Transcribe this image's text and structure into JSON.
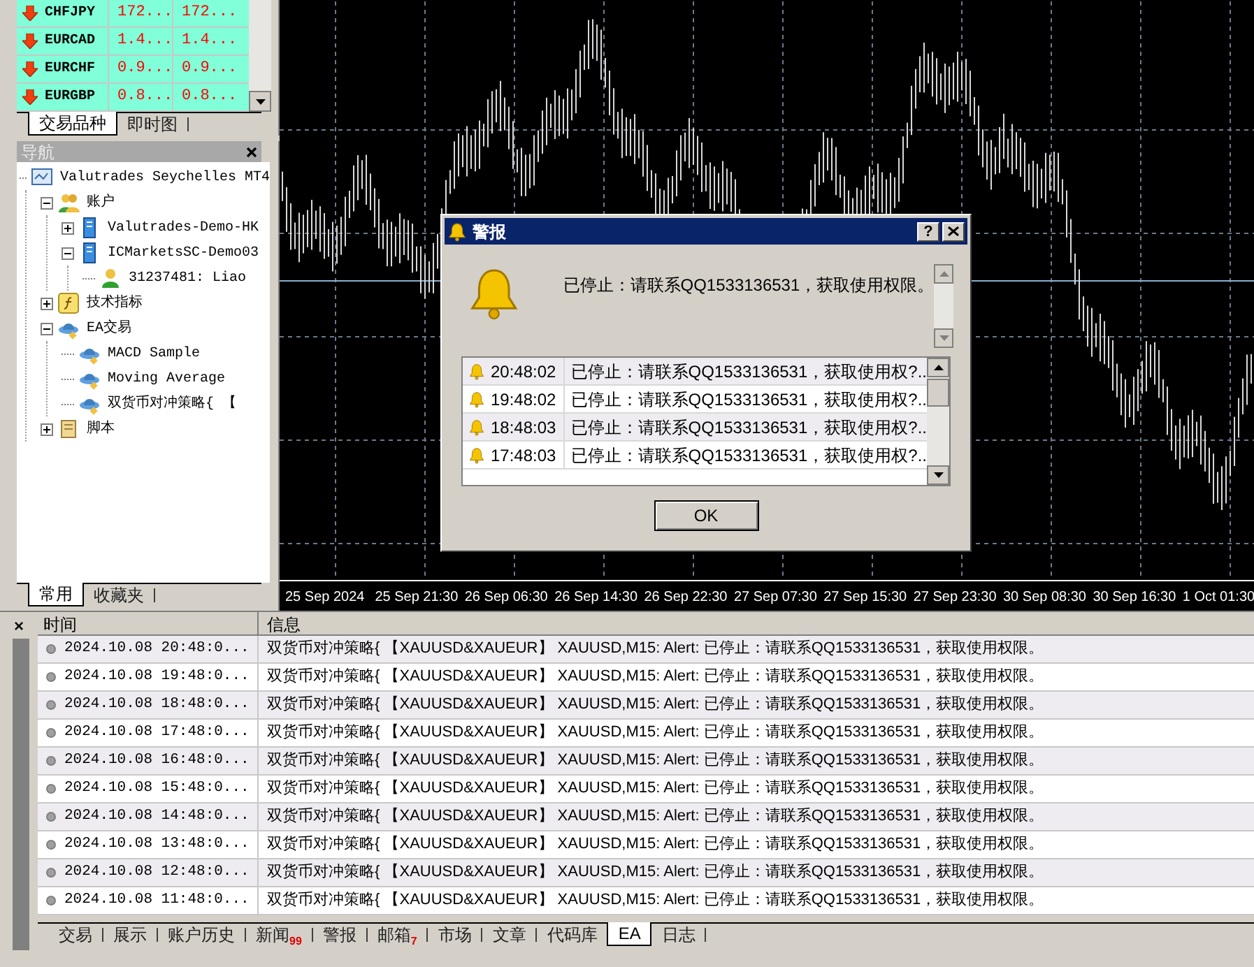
{
  "market_watch": {
    "rows": [
      {
        "symbol": "CHFJPY",
        "bid": "172...",
        "ask": "172..."
      },
      {
        "symbol": "EURCAD",
        "bid": "1.4...",
        "ask": "1.4..."
      },
      {
        "symbol": "EURCHF",
        "bid": "0.9...",
        "ask": "0.9..."
      },
      {
        "symbol": "EURGBP",
        "bid": "0.8...",
        "ask": "0.8..."
      }
    ],
    "tabs": [
      {
        "label": "交易品种",
        "selected": true
      },
      {
        "label": "即时图",
        "selected": false
      }
    ]
  },
  "navigator": {
    "title": "导航",
    "tree": [
      {
        "label": "Valutrades Seychelles MT4",
        "kind": "terminal",
        "children": [
          {
            "label": "账户",
            "kind": "accounts",
            "expanded": true,
            "children": [
              {
                "label": "Valutrades-Demo-HK",
                "kind": "server",
                "expanded": false
              },
              {
                "label": "ICMarketsSC-Demo03",
                "kind": "server",
                "expanded": true,
                "children": [
                  {
                    "label": "31237481: Liao",
                    "kind": "user"
                  }
                ]
              }
            ]
          },
          {
            "label": "技术指标",
            "kind": "indicator",
            "expanded": false
          },
          {
            "label": "EA交易",
            "kind": "experts",
            "expanded": true,
            "children": [
              {
                "label": "MACD Sample",
                "kind": "expert"
              },
              {
                "label": "Moving Average",
                "kind": "expert"
              },
              {
                "label": "双货币对冲策略{ 【",
                "kind": "expert"
              }
            ]
          },
          {
            "label": "脚本",
            "kind": "script",
            "expanded": false
          }
        ]
      }
    ],
    "tabs": [
      {
        "label": "常用",
        "selected": true
      },
      {
        "label": "收藏夹",
        "selected": false
      }
    ]
  },
  "chart": {
    "x_labels": [
      "25 Sep 2024",
      "25 Sep 21:30",
      "26 Sep 06:30",
      "26 Sep 14:30",
      "26 Sep 22:30",
      "27 Sep 07:30",
      "27 Sep 15:30",
      "27 Sep 23:30",
      "30 Sep 08:30",
      "30 Sep 16:30",
      "1 Oct 01:30"
    ]
  },
  "alert_dialog": {
    "title": "警报",
    "help": "?",
    "message": "已停止：请联系QQ1533136531，获取使用权限。",
    "list": [
      {
        "time": "20:48:02",
        "message": "已停止：请联系QQ1533136531，获取使用权?..",
        "selected": false
      },
      {
        "time": "19:48:02",
        "message": "已停止：请联系QQ1533136531，获取使用权?..",
        "selected": false
      },
      {
        "time": "18:48:03",
        "message": "已停止：请联系QQ1533136531，获取使用权?..",
        "selected": false
      },
      {
        "time": "17:48:03",
        "message": "已停止：请联系QQ1533136531，获取使用权?..",
        "selected": false
      }
    ],
    "ok": "OK"
  },
  "terminal": {
    "close": "×",
    "columns": [
      "时间",
      "信息"
    ],
    "rows": [
      {
        "time": "2024.10.08 20:48:0...",
        "message": "双货币对冲策略{ 【XAUUSD&XAUEUR】 XAUUSD,M15: Alert: 已停止：请联系QQ1533136531，获取使用权限。"
      },
      {
        "time": "2024.10.08 19:48:0...",
        "message": "双货币对冲策略{ 【XAUUSD&XAUEUR】 XAUUSD,M15: Alert: 已停止：请联系QQ1533136531，获取使用权限。"
      },
      {
        "time": "2024.10.08 18:48:0...",
        "message": "双货币对冲策略{ 【XAUUSD&XAUEUR】 XAUUSD,M15: Alert: 已停止：请联系QQ1533136531，获取使用权限。"
      },
      {
        "time": "2024.10.08 17:48:0...",
        "message": "双货币对冲策略{ 【XAUUSD&XAUEUR】 XAUUSD,M15: Alert: 已停止：请联系QQ1533136531，获取使用权限。"
      },
      {
        "time": "2024.10.08 16:48:0...",
        "message": "双货币对冲策略{ 【XAUUSD&XAUEUR】 XAUUSD,M15: Alert: 已停止：请联系QQ1533136531，获取使用权限。"
      },
      {
        "time": "2024.10.08 15:48:0...",
        "message": "双货币对冲策略{ 【XAUUSD&XAUEUR】 XAUUSD,M15: Alert: 已停止：请联系QQ1533136531，获取使用权限。"
      },
      {
        "time": "2024.10.08 14:48:0...",
        "message": "双货币对冲策略{ 【XAUUSD&XAUEUR】 XAUUSD,M15: Alert: 已停止：请联系QQ1533136531，获取使用权限。"
      },
      {
        "time": "2024.10.08 13:48:0...",
        "message": "双货币对冲策略{ 【XAUUSD&XAUEUR】 XAUUSD,M15: Alert: 已停止：请联系QQ1533136531，获取使用权限。"
      },
      {
        "time": "2024.10.08 12:48:0...",
        "message": "双货币对冲策略{ 【XAUUSD&XAUEUR】 XAUUSD,M15: Alert: 已停止：请联系QQ1533136531，获取使用权限。"
      },
      {
        "time": "2024.10.08 11:48:0...",
        "message": "双货币对冲策略{ 【XAUUSD&XAUEUR】 XAUUSD,M15: Alert: 已停止：请联系QQ1533136531，获取使用权限。"
      }
    ],
    "tabs": [
      {
        "label": "交易",
        "selected": false
      },
      {
        "label": "展示",
        "selected": false
      },
      {
        "label": "账户历史",
        "selected": false
      },
      {
        "label": "新闻",
        "badge": "99",
        "selected": false
      },
      {
        "label": "警报",
        "selected": false
      },
      {
        "label": "邮箱",
        "badge": "7",
        "selected": false
      },
      {
        "label": "市场",
        "selected": false
      },
      {
        "label": "文章",
        "selected": false
      },
      {
        "label": "代码库",
        "selected": false
      },
      {
        "label": "EA",
        "selected": true
      },
      {
        "label": "日志",
        "selected": false
      }
    ]
  }
}
